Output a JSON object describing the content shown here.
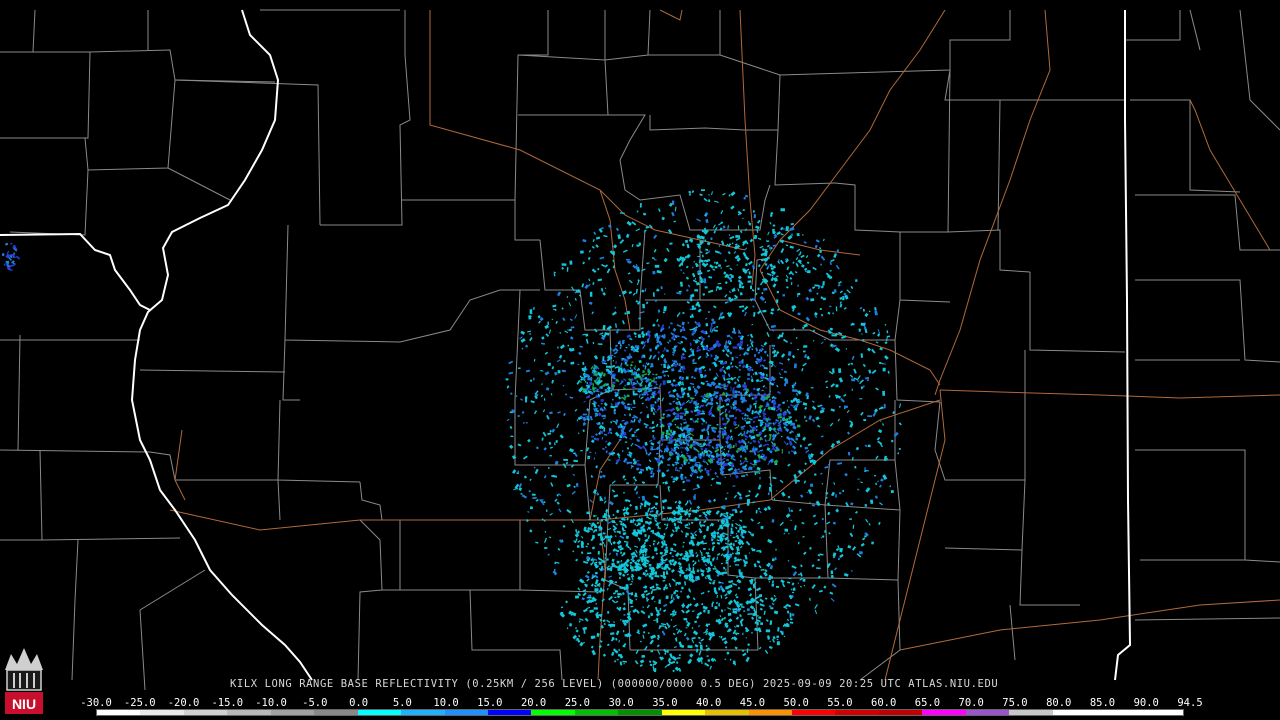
{
  "product": {
    "title": "KILX LONG RANGE BASE REFLECTIVITY (0.25KM / 256 LEVEL) (000000/0000 0.5 DEG) 2025-09-09 20:25 UTC  ATLAS.NIU.EDU"
  },
  "logo": {
    "text": "NIU",
    "color": "#c8102e"
  },
  "legend": {
    "labels": [
      "-30.0",
      "-25.0",
      "-20.0",
      "-15.0",
      "-10.0",
      "-5.0",
      "0.0",
      "5.0",
      "10.0",
      "15.0",
      "20.0",
      "25.0",
      "30.0",
      "35.0",
      "40.0",
      "45.0",
      "50.0",
      "55.0",
      "60.0",
      "65.0",
      "70.0",
      "75.0",
      "80.0",
      "85.0",
      "90.0",
      "94.5"
    ],
    "colors": [
      "#ffffff",
      "#e8e8e8",
      "#d0d0d0",
      "#b8b8b8",
      "#a0a0a0",
      "#888888",
      "#00ffff",
      "#1fb0ff",
      "#1e90ff",
      "#0000ff",
      "#00ff00",
      "#00c000",
      "#009000",
      "#ffff00",
      "#e6c000",
      "#ff9000",
      "#ff0000",
      "#d00000",
      "#c00000",
      "#ff00ff",
      "#9955c9",
      "#c8c8c8",
      "#ffffff",
      "#ffffff",
      "#ffffff"
    ]
  },
  "map_colors": {
    "county_lines": "#8a8a8a",
    "state_lines": "#ffffff",
    "roads": "#b06a3c",
    "echo_light": "#13c6d9",
    "echo_mid": "#1e7fe0",
    "echo_strong": "#2a3fd6",
    "echo_green": "#1ba84c"
  }
}
